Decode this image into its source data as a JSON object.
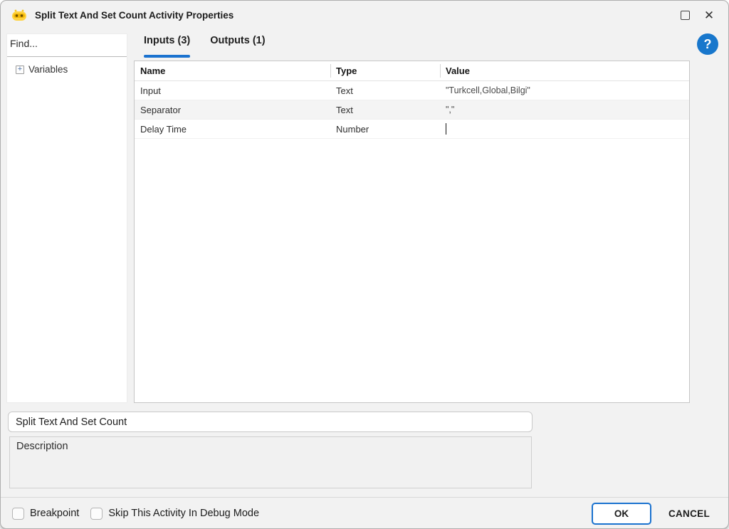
{
  "titlebar": {
    "title": "Split Text And Set Count Activity Properties"
  },
  "help": {
    "label": "?"
  },
  "sidebar": {
    "find_placeholder": "Find...",
    "tree": [
      {
        "expander": "+",
        "label": "Variables"
      }
    ]
  },
  "tabs": [
    {
      "label": "Inputs (3)",
      "active": true
    },
    {
      "label": "Outputs (1)",
      "active": false
    }
  ],
  "table": {
    "columns": [
      "Name",
      "Type",
      "Value"
    ],
    "rows": [
      {
        "name": "Input",
        "type": "Text",
        "value": "\"Turkcell,Global,Bilgi\""
      },
      {
        "name": "Separator",
        "type": "Text",
        "value": "\",\""
      },
      {
        "name": "Delay Time",
        "type": "Number",
        "value": ""
      }
    ]
  },
  "activity": {
    "name_value": "Split Text And Set Count",
    "description_placeholder": "Description"
  },
  "footer": {
    "checkboxes": [
      {
        "label": "Breakpoint",
        "checked": false
      },
      {
        "label": "Skip This Activity In Debug Mode",
        "checked": false
      }
    ],
    "ok_label": "OK",
    "cancel_label": "CANCEL"
  },
  "colors": {
    "accent_blue": "#1a72cf",
    "dialog_bg": "#f2f2f2",
    "help_fab": "#1877cc"
  }
}
